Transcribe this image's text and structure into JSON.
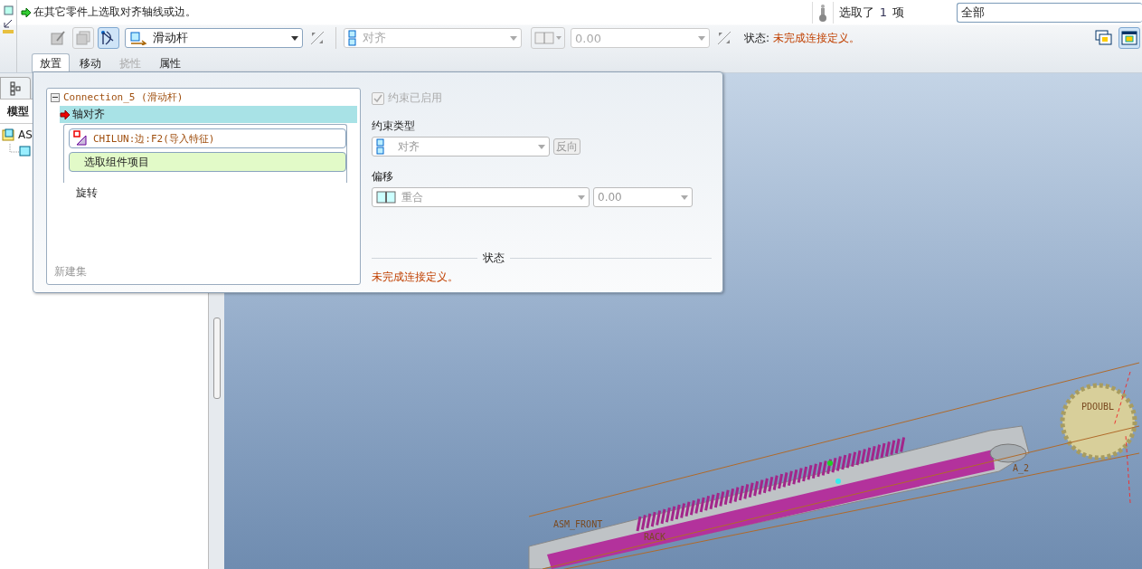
{
  "message": {
    "text": "在其它零件上选取对齐轴线或边。"
  },
  "selection": {
    "label_before": "选取了",
    "count": "1",
    "label_after": "项",
    "filter": "全部"
  },
  "toolbar": {
    "connection_type": "滑动杆",
    "constraint_type": "对齐",
    "offset_value": "0.00",
    "status_label": "状态:",
    "status_text": "未完成连接定义。"
  },
  "tabs": [
    {
      "label": "放置",
      "selected": true,
      "disabled": false
    },
    {
      "label": "移动",
      "selected": false,
      "disabled": false
    },
    {
      "label": "挠性",
      "selected": false,
      "disabled": true
    },
    {
      "label": "属性",
      "selected": false,
      "disabled": false
    }
  ],
  "model_tree": {
    "heading": "模型",
    "root": "AS"
  },
  "placement": {
    "set_title": "Connection_5 (滑动杆)",
    "expanded": true,
    "constraints": [
      {
        "label": "轴对齐",
        "selected": true,
        "references": [
          {
            "text": "CHILUN:边:F2(导入特征)",
            "kind": "reference"
          },
          {
            "text": "选取组件项目",
            "kind": "prompt"
          }
        ]
      },
      {
        "label": "旋转",
        "selected": false
      }
    ],
    "new_set": "新建集",
    "constraint_enabled": {
      "label": "约束已启用",
      "checked": true,
      "disabled": true
    },
    "constraint_type": {
      "label": "约束类型",
      "value": "对齐",
      "flip": "反向"
    },
    "offset": {
      "label": "偏移",
      "value": "重合",
      "amount": "0.00"
    },
    "status": {
      "title": "状态",
      "text": "未完成连接定义。"
    }
  },
  "viewport": {
    "labels": [
      "ASM_FRONT",
      "RACK",
      "A_2",
      "PDOUBL"
    ]
  }
}
